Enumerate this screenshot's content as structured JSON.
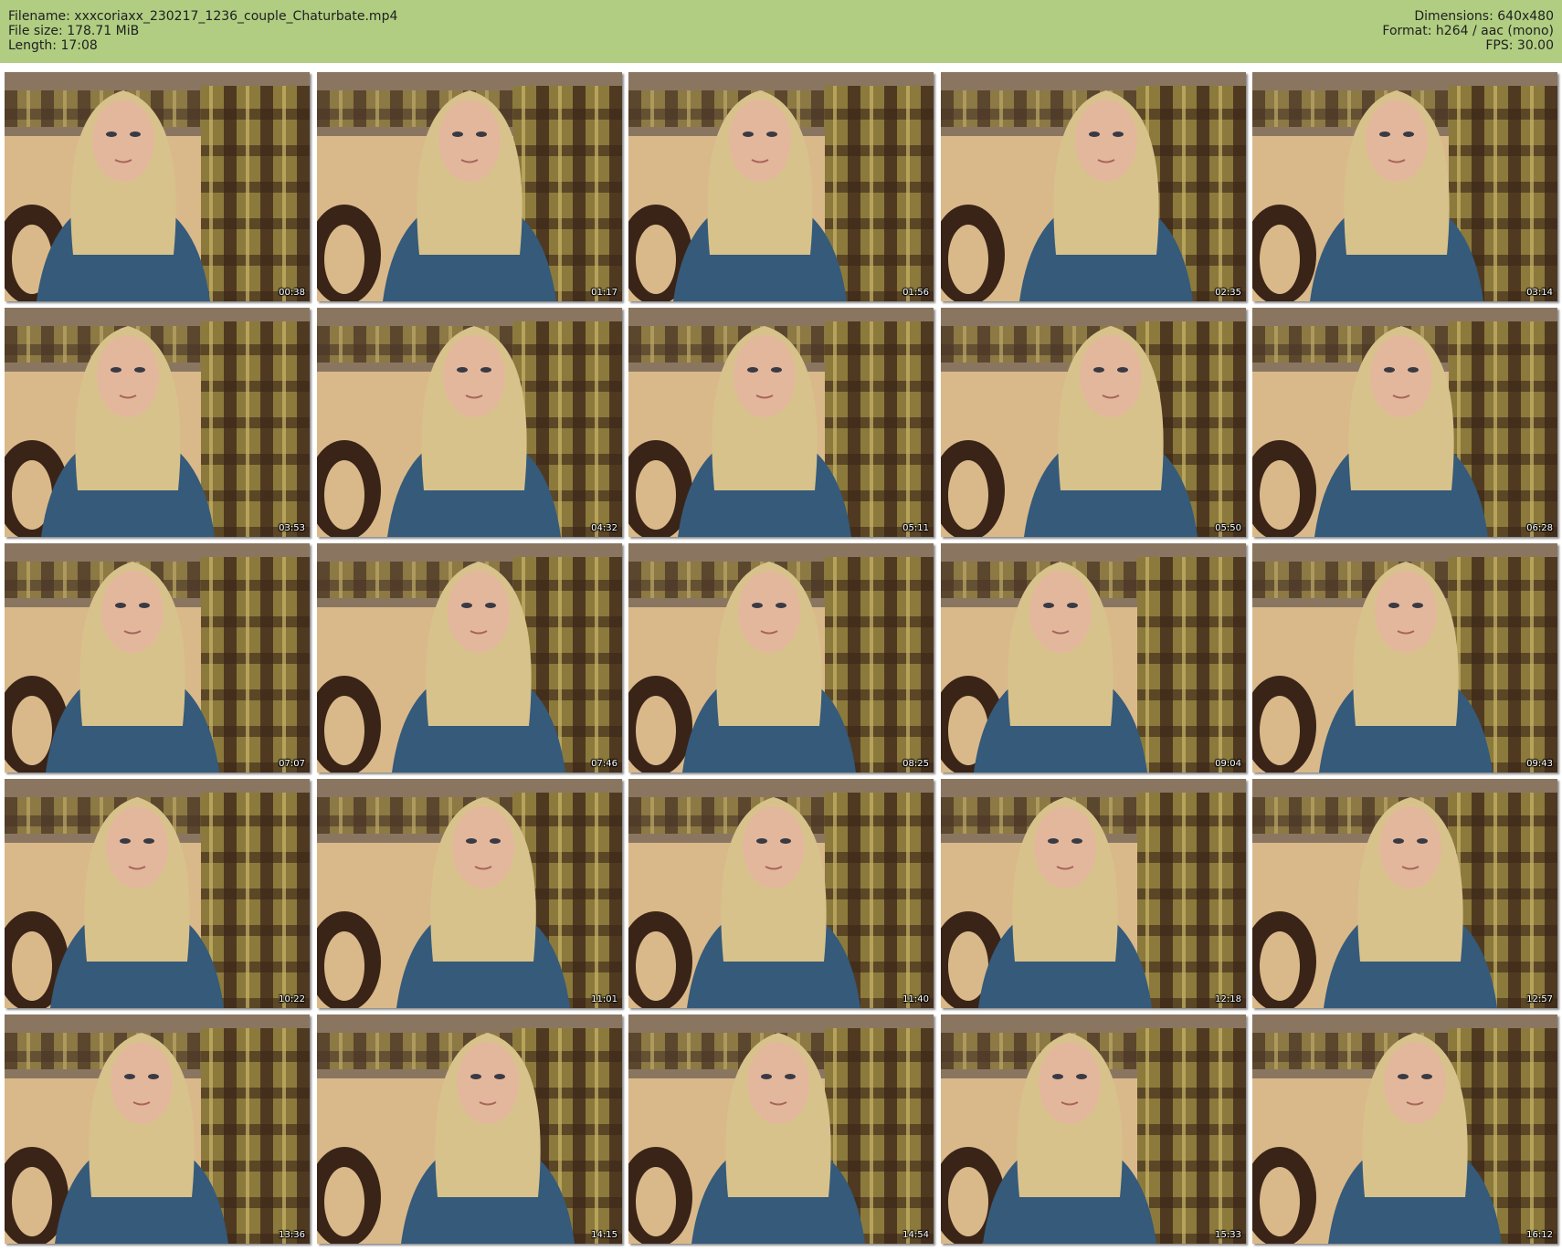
{
  "header": {
    "filename": "Filename: xxxcoriaxx_230217_1236_couple_Chaturbate.mp4",
    "filesize": "File size: 178.71 MiB",
    "length": "Length: 17:08",
    "dimensions": "Dimensions: 640x480",
    "format": "Format: h264 / aac (mono)",
    "fps": "FPS: 30.00"
  },
  "colors": {
    "header_bg": "#b0cd82",
    "couch_dark": "#3a2418",
    "couch_plaid": "#8c7a3c",
    "floor": "#d9b98a",
    "shirt": "#355a7a",
    "hair": "#d8c28c",
    "skin": "#e3b79c"
  },
  "thumbnails": [
    {
      "time": "00:38",
      "icon": "video-frame-icon"
    },
    {
      "time": "01:17",
      "icon": "video-frame-icon"
    },
    {
      "time": "01:56",
      "icon": "video-frame-icon"
    },
    {
      "time": "02:35",
      "icon": "video-frame-icon"
    },
    {
      "time": "03:14",
      "icon": "video-frame-icon"
    },
    {
      "time": "03:53",
      "icon": "video-frame-icon"
    },
    {
      "time": "04:32",
      "icon": "video-frame-icon"
    },
    {
      "time": "05:11",
      "icon": "video-frame-icon"
    },
    {
      "time": "05:50",
      "icon": "video-frame-icon"
    },
    {
      "time": "06:28",
      "icon": "video-frame-icon"
    },
    {
      "time": "07:07",
      "icon": "video-frame-icon"
    },
    {
      "time": "07:46",
      "icon": "video-frame-icon"
    },
    {
      "time": "08:25",
      "icon": "video-frame-icon"
    },
    {
      "time": "09:04",
      "icon": "video-frame-icon"
    },
    {
      "time": "09:43",
      "icon": "video-frame-icon"
    },
    {
      "time": "10:22",
      "icon": "video-frame-icon"
    },
    {
      "time": "11:01",
      "icon": "video-frame-icon"
    },
    {
      "time": "11:40",
      "icon": "video-frame-icon"
    },
    {
      "time": "12:18",
      "icon": "video-frame-icon"
    },
    {
      "time": "12:57",
      "icon": "video-frame-icon"
    },
    {
      "time": "13:36",
      "icon": "video-frame-icon"
    },
    {
      "time": "14:15",
      "icon": "video-frame-icon"
    },
    {
      "time": "14:54",
      "icon": "video-frame-icon"
    },
    {
      "time": "15:33",
      "icon": "video-frame-icon"
    },
    {
      "time": "16:12",
      "icon": "video-frame-icon"
    }
  ]
}
